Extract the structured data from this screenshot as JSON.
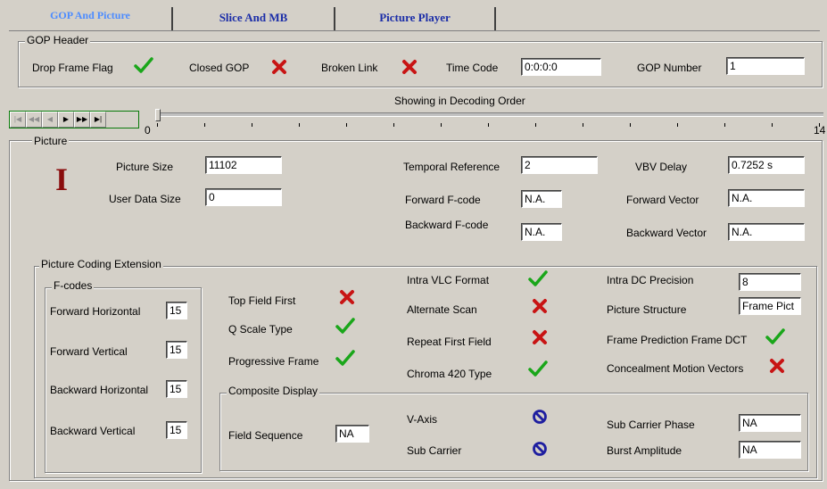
{
  "tabs": [
    {
      "label": "GOP  And  Picture"
    },
    {
      "label": "Slice  And  MB"
    },
    {
      "label": "Picture  Player"
    }
  ],
  "gop_header": {
    "title": "GOP Header",
    "drop_frame_flag_label": "Drop Frame Flag",
    "closed_gop_label": "Closed GOP",
    "broken_link_label": "Broken Link",
    "time_code_label": "Time Code",
    "time_code_value": "0:0:0:0",
    "gop_number_label": "GOP Number",
    "gop_number_value": "1"
  },
  "player": {
    "order_label": "Showing in Decoding Order",
    "slider_min": "0",
    "slider_max": "14",
    "slider_position": 0
  },
  "picture": {
    "title": "Picture",
    "type_glyph": "I",
    "picture_size_label": "Picture Size",
    "picture_size_value": "11102",
    "user_data_size_label": "User Data Size",
    "user_data_size_value": "0",
    "temporal_reference_label": "Temporal Reference",
    "temporal_reference_value": "2",
    "forward_fcode_label": "Forward F-code",
    "forward_fcode_value": "N.A.",
    "backward_fcode_label": "Backward F-code",
    "backward_fcode_value": "N.A.",
    "vbv_delay_label": "VBV Delay",
    "vbv_delay_value": "0.7252 s",
    "forward_vector_label": "Forward Vector",
    "forward_vector_value": "N.A.",
    "backward_vector_label": "Backward Vector",
    "backward_vector_value": "N.A."
  },
  "pce": {
    "title": "Picture Coding Extension",
    "fcodes_title": "F-codes",
    "forward_horizontal_label": "Forward Horizontal",
    "forward_horizontal_value": "15",
    "forward_vertical_label": "Forward Vertical",
    "forward_vertical_value": "15",
    "backward_horizontal_label": "Backward Horizontal",
    "backward_horizontal_value": "15",
    "backward_vertical_label": "Backward Vertical",
    "backward_vertical_value": "15",
    "top_field_first_label": "Top Field First",
    "q_scale_type_label": "Q Scale Type",
    "progressive_frame_label": "Progressive Frame",
    "intra_vlc_format_label": "Intra VLC Format",
    "alternate_scan_label": "Alternate Scan",
    "repeat_first_field_label": "Repeat First Field",
    "chroma_420_type_label": "Chroma 420 Type",
    "intra_dc_precision_label": "Intra DC Precision",
    "intra_dc_precision_value": "8",
    "picture_structure_label": "Picture Structure",
    "picture_structure_value": "Frame Pict",
    "frame_pred_frame_dct_label": "Frame Prediction Frame DCT",
    "concealment_motion_vectors_label": "Concealment Motion Vectors"
  },
  "composite": {
    "title": "Composite Display",
    "field_sequence_label": "Field Sequence",
    "field_sequence_value": "NA",
    "v_axis_label": "V-Axis",
    "sub_carrier_label": "Sub Carrier",
    "sub_carrier_phase_label": "Sub Carrier Phase",
    "sub_carrier_phase_value": "NA",
    "burst_amplitude_label": "Burst Amplitude",
    "burst_amplitude_value": "NA"
  },
  "colors": {
    "check": "#1aa61a",
    "cross": "#c81414",
    "no": "#1e1ea0",
    "tab_active": "#4d8cff",
    "tab_text": "#1c2ea8"
  }
}
